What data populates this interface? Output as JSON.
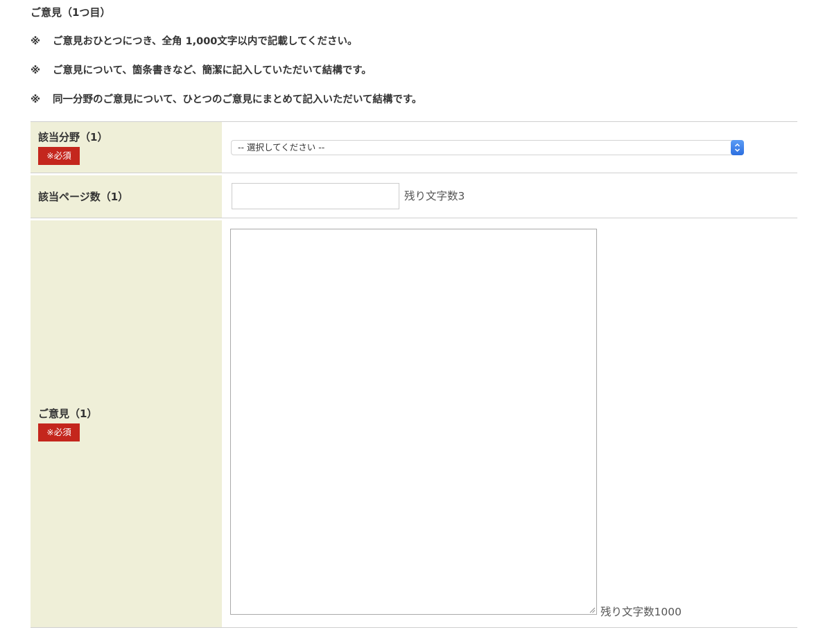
{
  "section_title": "ご意見（1つ目）",
  "notes": [
    {
      "mark": "※",
      "text": "ご意見おひとつにつき、全角 1,000文字以内で記載してください。"
    },
    {
      "mark": "※",
      "text": "ご意見について、箇条書きなど、簡潔に記入していただいて結構です。"
    },
    {
      "mark": "※",
      "text": "同一分野のご意見について、ひとつのご意見にまとめて記入いただいて結構です。"
    }
  ],
  "form": {
    "field_category": {
      "label": "該当分野（1）",
      "required_badge": "※必須",
      "selected_option": "-- 選択してください --"
    },
    "field_page": {
      "label": "該当ページ数（1）",
      "value": "",
      "counter": "残り文字数3"
    },
    "field_opinion": {
      "label": "ご意見（1）",
      "required_badge": "※必須",
      "value": "",
      "counter": "残り文字数1000"
    }
  },
  "colors": {
    "label_background": "#efefd8",
    "required_badge": "#c4261d",
    "select_arrow": "#2c6fe0",
    "divider": "#cfcfcf"
  }
}
